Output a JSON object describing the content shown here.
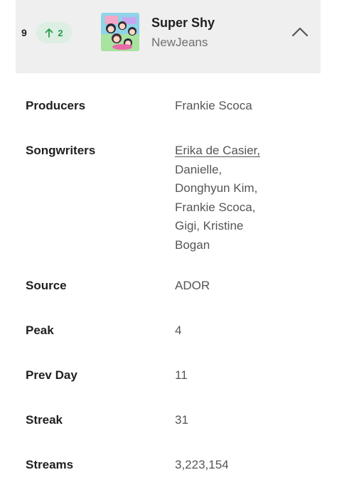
{
  "track": {
    "rank": "9",
    "change": "2",
    "title": "Super Shy",
    "artist": "NewJeans"
  },
  "details": {
    "producers": {
      "label": "Producers",
      "value": "Frankie Scoca"
    },
    "songwriters": {
      "label": "Songwriters",
      "first": "Erika de Casier,",
      "lines": [
        "Danielle,",
        "Donghyun Kim,",
        "Frankie Scoca,",
        "Gigi, Kristine",
        "Bogan"
      ]
    },
    "source": {
      "label": "Source",
      "value": "ADOR"
    },
    "peak": {
      "label": "Peak",
      "value": "4"
    },
    "prev_day": {
      "label": "Prev Day",
      "value": "11"
    },
    "streak": {
      "label": "Streak",
      "value": "31"
    },
    "streams": {
      "label": "Streams",
      "value": "3,223,154"
    }
  },
  "colors": {
    "up": "#2a9a4e",
    "badge_bg": "#dcefe2",
    "header_bg": "#efefef"
  },
  "icons": {
    "change": "arrow-up-icon",
    "collapse": "chevron-up-icon"
  }
}
